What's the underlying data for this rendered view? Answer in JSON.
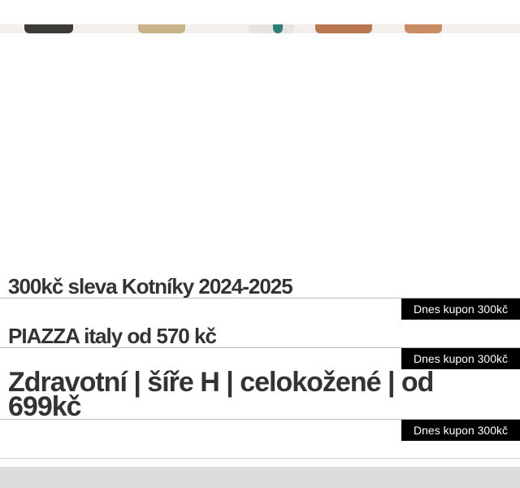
{
  "colors": {
    "title_text": "#333333",
    "coupon_bg": "#000000",
    "coupon_text": "#ffffff",
    "divider": "#bdbdbd",
    "footer_bg": "#dcdddc"
  },
  "promos": [
    {
      "title": "300kč sleva Kotníky 2024-2025",
      "coupon_label": "Dnes kupon 300kč"
    },
    {
      "title": "PIAZZA italy od 570 kč",
      "coupon_label": "Dnes kupon 300kč"
    },
    {
      "title": "Zdravotní | šíře H | celokožené | od 699kč",
      "coupon_label": "Dnes kupon 300kč"
    }
  ]
}
